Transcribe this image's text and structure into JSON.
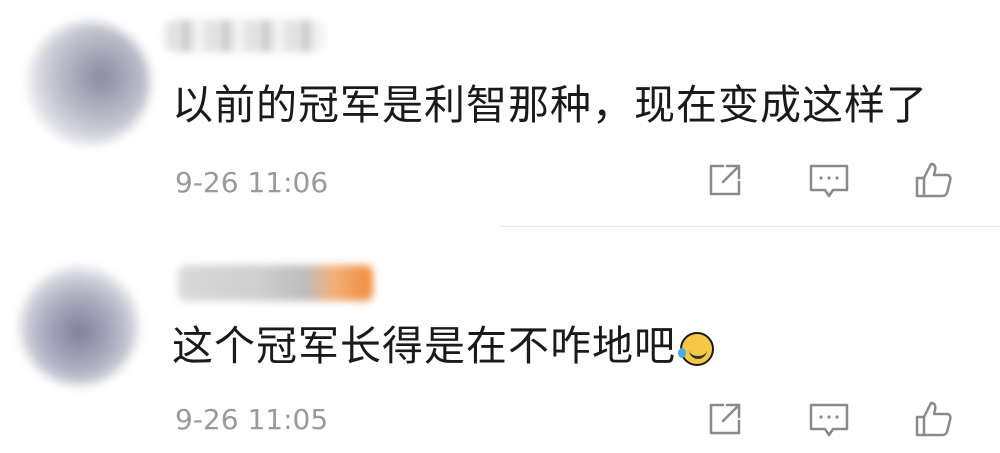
{
  "comments": [
    {
      "text": "以前的冠军是利智那种，现在变成这样了",
      "time": "9-26 11:06",
      "has_emoji": false
    },
    {
      "text": "这个冠军长得是在不咋地吧",
      "time": "9-26 11:05",
      "has_emoji": true,
      "emoji_icon": "laughing-crying-emoji-icon"
    }
  ],
  "icons": {
    "share": "share-icon",
    "reply": "comment-icon",
    "like": "thumbs-up-icon"
  },
  "colors": {
    "text": "#1a1a1a",
    "meta": "#9a9a9a",
    "icon_stroke": "#8a8a8a"
  }
}
